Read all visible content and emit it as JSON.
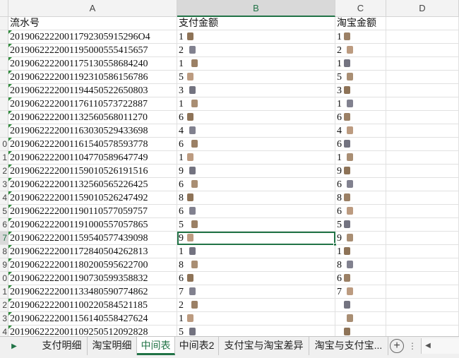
{
  "columns": [
    "A",
    "B",
    "C",
    "D"
  ],
  "row_numbers": [
    "",
    "",
    "",
    "",
    "",
    "",
    "",
    "",
    "",
    "0",
    "1",
    "2",
    "3",
    "4",
    "5",
    "6",
    "7",
    "8",
    "9",
    "0",
    "1",
    "2",
    "3",
    "4"
  ],
  "header_row": {
    "a": "流水号",
    "b": "支付金额",
    "c": "淘宝金额"
  },
  "rows": [
    {
      "a": "20190622220011792305915296O4",
      "b": "1",
      "c": "1"
    },
    {
      "a": "2019062222001195000555415657",
      "b": "2",
      "c": "2"
    },
    {
      "a": "2019062222001175130558684240",
      "b": "1",
      "c": "1"
    },
    {
      "a": "2019062222001192310586156786",
      "b": "5",
      "c": "5"
    },
    {
      "a": "2019062222001194450522650803",
      "b": "3",
      "c": "3"
    },
    {
      "a": "2019062222001176110573722887",
      "b": "1",
      "c": "1"
    },
    {
      "a": "2019062222001132560568011270",
      "b": "6",
      "c": "6"
    },
    {
      "a": "2019062222001163030529433698",
      "b": "4",
      "c": "4"
    },
    {
      "a": "2019062222001161540578593778",
      "b": "6",
      "c": "6"
    },
    {
      "a": "2019062222001104770589647749",
      "b": "1",
      "c": "1"
    },
    {
      "a": "2019062222001159010526191516",
      "b": "9",
      "c": "9"
    },
    {
      "a": "2019062222001132560565226425",
      "b": "6",
      "c": "6"
    },
    {
      "a": "2019062222001159010526247492",
      "b": "8",
      "c": "8"
    },
    {
      "a": "2019062222001190110577059757",
      "b": "6",
      "c": "6"
    },
    {
      "a": "2019062222001191000557057865",
      "b": "5",
      "c": "5"
    },
    {
      "a": "2019062222001159540577439098",
      "b": "9",
      "c": "9"
    },
    {
      "a": "2019062222001172840504262813",
      "b": "1",
      "c": "1"
    },
    {
      "a": "2019062222001180200595622700",
      "b": "8",
      "c": "8"
    },
    {
      "a": "2019062222001190730599358832",
      "b": "6",
      "c": "6"
    },
    {
      "a": "2019062222001133480590774862",
      "b": "7",
      "c": "7"
    },
    {
      "a": "2019062222001100220584521185",
      "b": "2",
      "c": ""
    },
    {
      "a": "2019062222001156140558427624",
      "b": "1",
      "c": ""
    },
    {
      "a": "2019062222001109250512092828",
      "b": "5",
      "c": ""
    }
  ],
  "sheet_tabs": [
    "支付明细",
    "淘宝明细",
    "中间表",
    "中间表2",
    "支付宝与淘宝差异",
    "淘宝与支付宝..."
  ],
  "active_tab_index": 2,
  "add_sheet_symbol": "+",
  "nav_arrow": "▶",
  "more_symbol": "⋮",
  "scroll_arrow": "◀",
  "colors": {
    "accent": "#217346",
    "flag": "#2e8b3a"
  }
}
